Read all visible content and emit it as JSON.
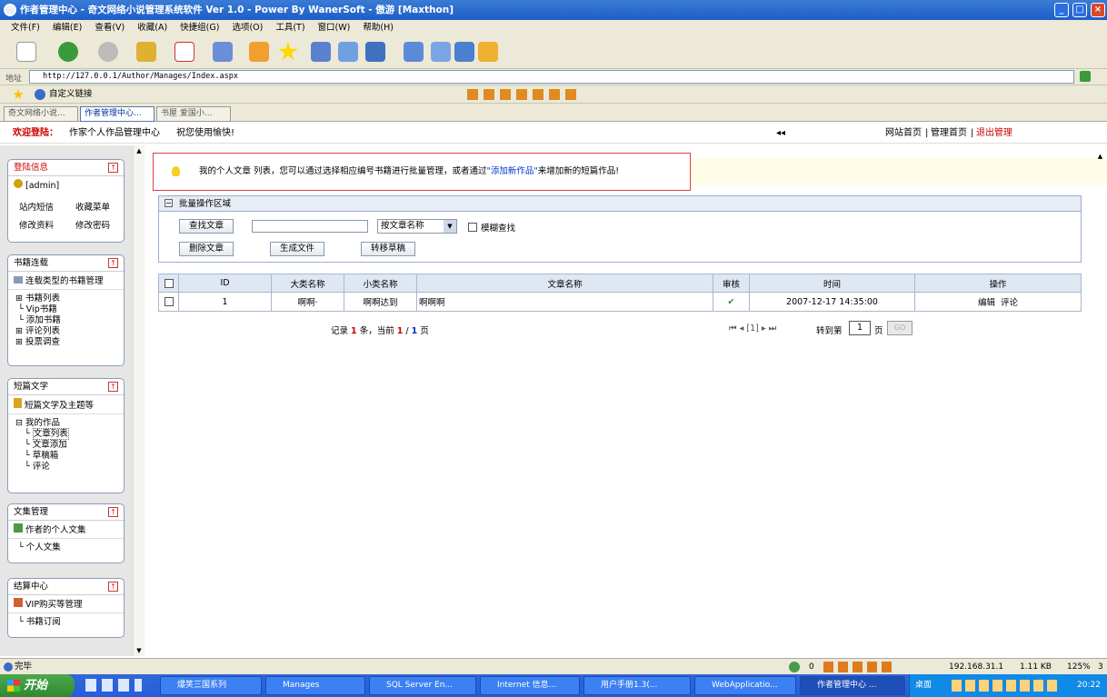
{
  "window": {
    "title": "作者管理中心 - 奇文网络小说管理系统软件 Ver 1.0 - Power By WanerSoft - 傲游 [Maxthon]"
  },
  "menu": [
    "文件(F)",
    "编辑(E)",
    "查看(V)",
    "收藏(A)",
    "快捷组(G)",
    "选项(O)",
    "工具(T)",
    "窗口(W)",
    "帮助(H)"
  ],
  "address": {
    "label": "地址",
    "url": "http://127.0.0.1/Author/Manages/Index.aspx"
  },
  "linksbar": {
    "label": "自定义链接"
  },
  "tabs": [
    "奇文网络小说...",
    "作者管理中心...",
    "书屋 爱国小..."
  ],
  "welcome": {
    "lead": "欢迎登陆：",
    "center": "作家个人作品管理中心",
    "wish": "祝您使用愉快!",
    "arrows": "◂◂",
    "links": [
      "网站首页",
      "管理首页",
      "退出管理"
    ]
  },
  "sidebar": {
    "login": {
      "title": "登陆信息",
      "user": "[admin]",
      "links": [
        "站内短信",
        "收藏菜单",
        "修改资料",
        "修改密码"
      ]
    },
    "books": {
      "title": "书籍连载",
      "sub": "连载类型的书籍管理",
      "items": [
        "书籍列表",
        "Vip书籍",
        "添加书籍",
        "评论列表",
        "投票调查"
      ]
    },
    "short": {
      "title": "短篇文学",
      "sub": "短篇文学及主题等",
      "root": "我的作品",
      "items": [
        "文章列表",
        "文章添加",
        "草稿箱",
        "评论"
      ]
    },
    "collect": {
      "title": "文集管理",
      "sub": "作者的个人文集",
      "items": [
        "个人文集"
      ]
    },
    "settle": {
      "title": "结算中心",
      "sub": "VIP购买等管理",
      "items": [
        "书籍订阅"
      ]
    }
  },
  "notice": {
    "before": "我的个人文章 列表，您可以通过选择相应编号书籍进行批量管理，或者通过",
    "link": "\"添加新作品\"",
    "after": "来增加新的短篇作品!"
  },
  "batch": {
    "title": "批量操作区域",
    "find": "查找文章",
    "select": "按文章名称",
    "fuzzy": "模糊查找",
    "delete": "删除文章",
    "gen": "生成文件",
    "move": "转移草稿"
  },
  "table": {
    "headers": [
      "ID",
      "大类名称",
      "小类名称",
      "文章名称",
      "审核",
      "时间",
      "操作"
    ],
    "rows": [
      {
        "id": "1",
        "cat": "啊啊·",
        "sub": "啊啊达到",
        "name": "啊啊啊",
        "check": "✔",
        "time": "2007-12-17 14:35:00",
        "edit": "编辑",
        "comment": "评论"
      }
    ]
  },
  "pager": {
    "rec": "记录",
    "count": "1",
    "unit": "条，当前",
    "page": "1",
    "sep": "/",
    "total": "1",
    "pageunit": "页",
    "nav": "⏮ ◂ [1] ▸ ⏭",
    "jump": "转到第",
    "jumpval": "1",
    "ye": "页",
    "go": "GO"
  },
  "status": {
    "text": "完毕",
    "num": "0",
    "ip": "192.168.31.1",
    "size": "1.11 KB",
    "zoom": "125%",
    "tail": "3"
  },
  "taskbar": {
    "start": "开始",
    "tasks": [
      "爆笑三国系列",
      "Manages",
      "SQL Server En...",
      "Internet 信息...",
      "用户手册1.3(...",
      "WebApplicatio...",
      "作者管理中心 ..."
    ],
    "tray_label": "桌面",
    "time": "20:22"
  }
}
